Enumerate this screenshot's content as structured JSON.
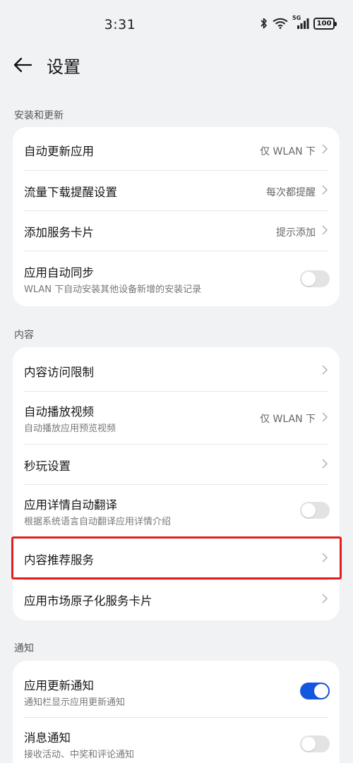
{
  "status_bar": {
    "time": "3:31",
    "network": "5G",
    "battery": "100"
  },
  "header": {
    "title": "设置"
  },
  "sections": {
    "install": {
      "label": "安装和更新",
      "auto_update": {
        "title": "自动更新应用",
        "value": "仅 WLAN 下"
      },
      "data_download": {
        "title": "流量下载提醒设置",
        "value": "每次都提醒"
      },
      "service_card": {
        "title": "添加服务卡片",
        "value": "提示添加"
      },
      "auto_sync": {
        "title": "应用自动同步",
        "subtitle": "WLAN 下自动安装其他设备新增的安装记录",
        "enabled": false
      }
    },
    "content": {
      "label": "内容",
      "access_limit": {
        "title": "内容访问限制"
      },
      "autoplay_video": {
        "title": "自动播放视频",
        "subtitle": "自动播放应用预览视频",
        "value": "仅 WLAN 下"
      },
      "instant_play": {
        "title": "秒玩设置"
      },
      "auto_translate": {
        "title": "应用详情自动翻译",
        "subtitle": "根据系统语言自动翻译应用详情介绍",
        "enabled": false
      },
      "recommend_service": {
        "title": "内容推荐服务"
      },
      "atomic_card": {
        "title": "应用市场原子化服务卡片"
      }
    },
    "notify": {
      "label": "通知",
      "update_notify": {
        "title": "应用更新通知",
        "subtitle": "通知栏显示应用更新通知",
        "enabled": true
      },
      "message_notify": {
        "title": "消息通知",
        "subtitle": "接收活动、中奖和评论通知",
        "enabled": false
      }
    }
  },
  "colors": {
    "accent": "#1356e0",
    "highlight": "#e02020",
    "background": "#f1f2f4"
  }
}
